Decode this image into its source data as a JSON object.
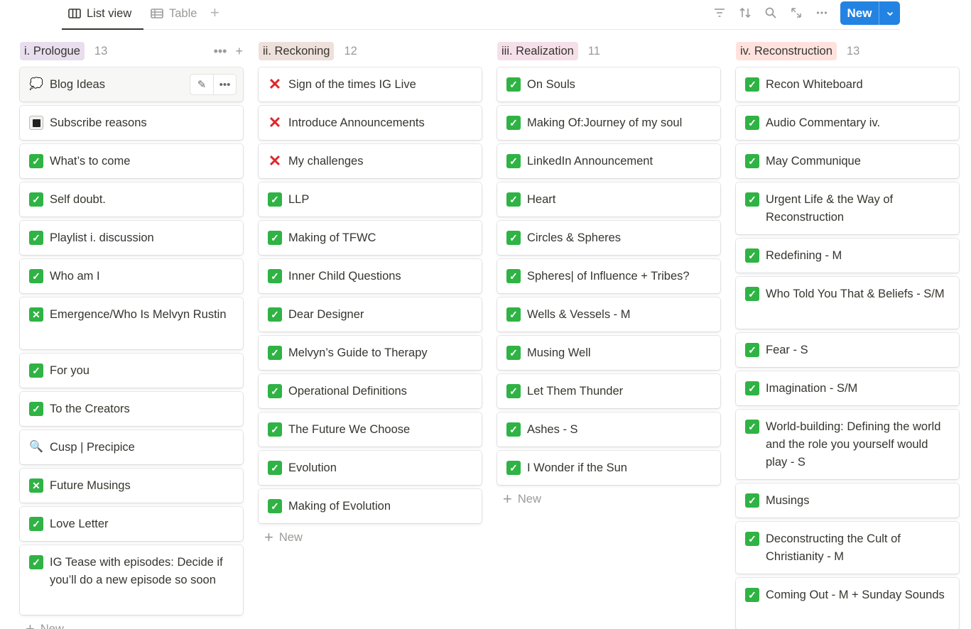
{
  "toolbar": {
    "tabs": [
      {
        "label": "List view",
        "active": true
      },
      {
        "label": "Table",
        "active": false
      }
    ],
    "new_label": "New",
    "accent": "#2383e2"
  },
  "columns": [
    {
      "name": "i. Prologue",
      "count": "13",
      "color": "#e8deee",
      "cards": [
        {
          "icon": "bubble",
          "title": "Blog Ideas"
        },
        {
          "icon": "square",
          "title": "Subscribe reasons"
        },
        {
          "icon": "check",
          "title": "What’s to come"
        },
        {
          "icon": "check",
          "title": "Self doubt."
        },
        {
          "icon": "check",
          "title": "Playlist i.  discussion"
        },
        {
          "icon": "check",
          "title": "Who am I"
        },
        {
          "icon": "greenx",
          "title": "Emergence/Who Is Melvyn Rustin"
        },
        {
          "icon": "check",
          "title": "For you"
        },
        {
          "icon": "check",
          "title": "To the Creators"
        },
        {
          "icon": "mag",
          "title": "Cusp | Precipice"
        },
        {
          "icon": "greenx",
          "title": "Future Musings"
        },
        {
          "icon": "check",
          "title": "Love Letter"
        },
        {
          "icon": "check",
          "title": "IG Tease with episodes: Decide if you’ll do a new episode so soon"
        }
      ],
      "new_label": "New"
    },
    {
      "name": "ii. Reckoning",
      "count": "12",
      "color": "#eee0da",
      "cards": [
        {
          "icon": "x",
          "title": "Sign of the times IG Live"
        },
        {
          "icon": "x",
          "title": "Introduce Announcements"
        },
        {
          "icon": "x",
          "title": "My challenges"
        },
        {
          "icon": "check",
          "title": "LLP"
        },
        {
          "icon": "check",
          "title": "Making of TFWC"
        },
        {
          "icon": "check",
          "title": "Inner Child Questions"
        },
        {
          "icon": "check",
          "title": "Dear Designer"
        },
        {
          "icon": "check",
          "title": "Melvyn’s Guide to Therapy"
        },
        {
          "icon": "check",
          "title": "Operational Definitions"
        },
        {
          "icon": "check",
          "title": "The Future We Choose"
        },
        {
          "icon": "check",
          "title": "Evolution"
        },
        {
          "icon": "check",
          "title": "Making of Evolution"
        }
      ],
      "new_label": "New"
    },
    {
      "name": "iii. Realization",
      "count": "11",
      "color": "#f5e0e9",
      "cards": [
        {
          "icon": "check",
          "title": "On Souls"
        },
        {
          "icon": "check",
          "title": "Making Of:Journey of my soul"
        },
        {
          "icon": "check",
          "title": "LinkedIn Announcement"
        },
        {
          "icon": "check",
          "title": "Heart"
        },
        {
          "icon": "check",
          "title": "Circles & Spheres"
        },
        {
          "icon": "check",
          "title": "Spheres| of Influence + Tribes?"
        },
        {
          "icon": "check",
          "title": "Wells & Vessels - M"
        },
        {
          "icon": "check",
          "title": "Musing Well"
        },
        {
          "icon": "check",
          "title": "Let Them Thunder"
        },
        {
          "icon": "check",
          "title": "Ashes - S"
        },
        {
          "icon": "check",
          "title": "I Wonder if the Sun"
        }
      ],
      "new_label": "New"
    },
    {
      "name": "iv. Reconstruction",
      "count": "13",
      "color": "#ffe2dd",
      "cards": [
        {
          "icon": "check",
          "title": "Recon Whiteboard"
        },
        {
          "icon": "check",
          "title": "Audio Commentary iv."
        },
        {
          "icon": "check",
          "title": "May Communique"
        },
        {
          "icon": "check",
          "title": "Urgent Life & the Way of Reconstruction"
        },
        {
          "icon": "check",
          "title": "Redefining - M"
        },
        {
          "icon": "check",
          "title": "Who Told You That & Beliefs - S/M"
        },
        {
          "icon": "check",
          "title": "Fear - S"
        },
        {
          "icon": "check",
          "title": "Imagination - S/M"
        },
        {
          "icon": "check",
          "title": "World-building: Defining the world and the role you yourself would play - S"
        },
        {
          "icon": "check",
          "title": "Musings"
        },
        {
          "icon": "check",
          "title": "Deconstructing the Cult of Christianity - M"
        },
        {
          "icon": "check",
          "title": "Coming Out - M + Sunday Sounds"
        }
      ]
    }
  ]
}
